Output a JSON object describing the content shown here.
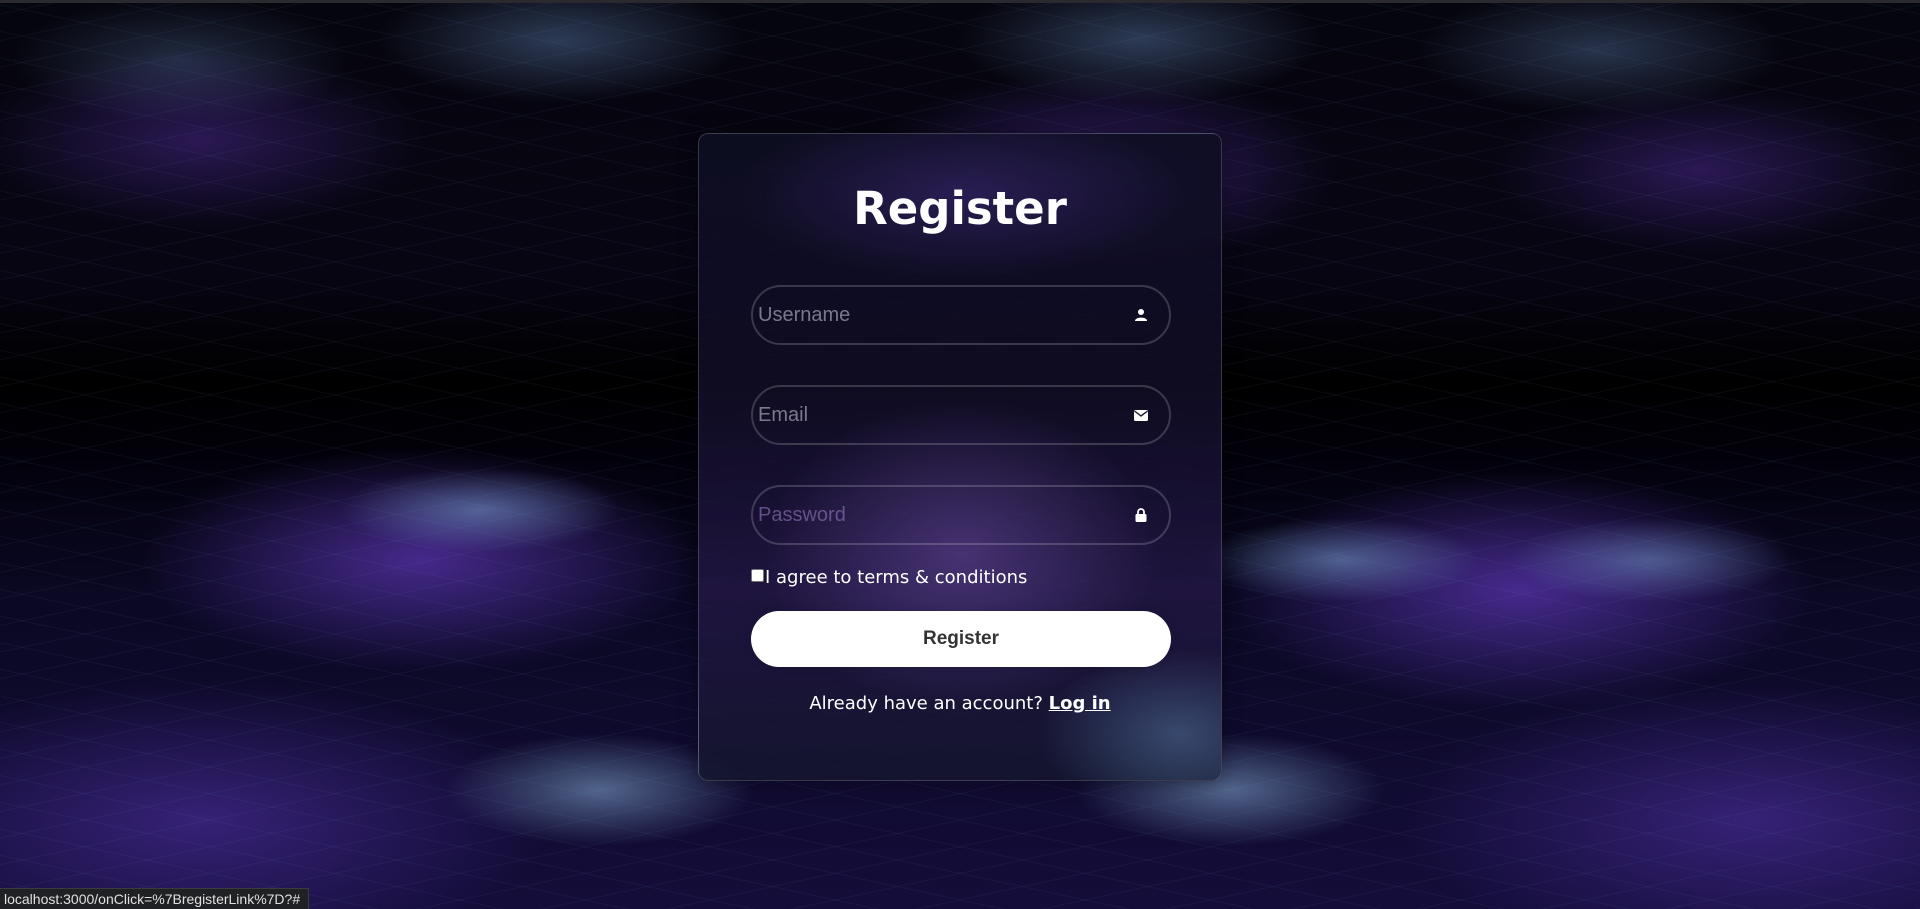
{
  "form": {
    "title": "Register",
    "fields": [
      {
        "placeholder": "Username",
        "value": "",
        "icon": "user-icon"
      },
      {
        "placeholder": "Email",
        "value": "",
        "icon": "envelope-icon"
      },
      {
        "placeholder": "Password",
        "value": "",
        "icon": "lock-icon"
      }
    ],
    "terms_label": "I agree to terms & conditions",
    "terms_checked": false,
    "submit_label": "Register",
    "login_prompt": "Already have an account?",
    "login_link": "Log in"
  },
  "status_bar": {
    "url": "localhost:3000/onClick=%7BregisterLink%7D?#"
  },
  "colors": {
    "card_border": "#ffffff2e",
    "button_bg": "#ffffff",
    "button_text": "#333333",
    "text": "#ffffff"
  }
}
